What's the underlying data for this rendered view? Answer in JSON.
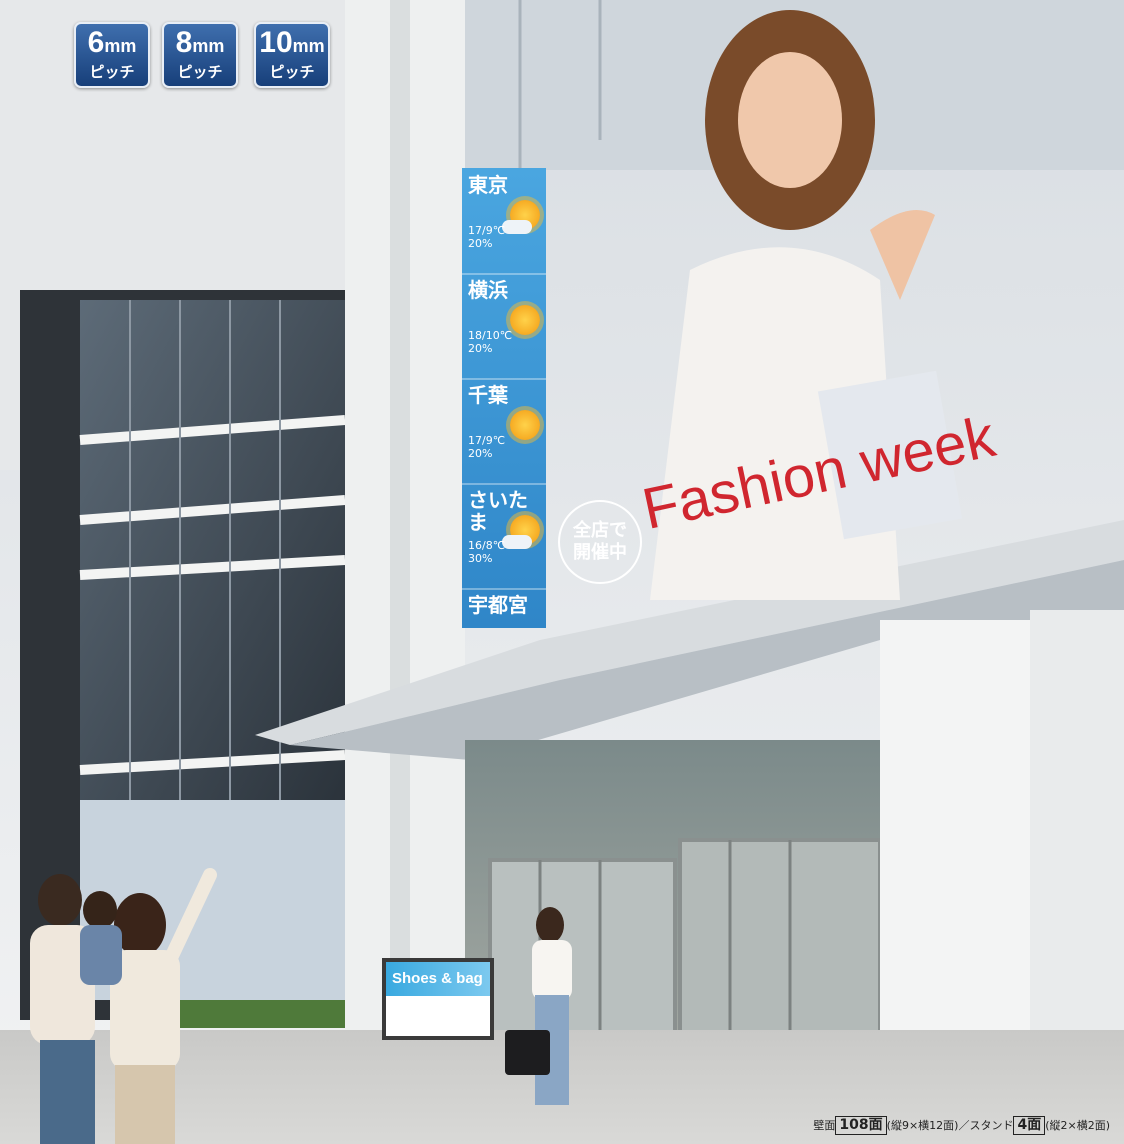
{
  "pitch_badges": [
    {
      "size": "6",
      "unit": "mm",
      "label": "ピッチ"
    },
    {
      "size": "8",
      "unit": "mm",
      "label": "ピッチ"
    },
    {
      "size": "10",
      "unit": "mm",
      "label": "ピッチ"
    }
  ],
  "weather": [
    {
      "city": "東京",
      "temp": "17/9℃",
      "chance": "20%",
      "icon": "sun-cloud-icon"
    },
    {
      "city": "横浜",
      "temp": "18/10℃",
      "chance": "20%",
      "icon": "sun-icon"
    },
    {
      "city": "千葉",
      "temp": "17/9℃",
      "chance": "20%",
      "icon": "sun-icon"
    },
    {
      "city": "さいたま",
      "temp": "16/8℃",
      "chance": "30%",
      "icon": "sun-cloud-icon"
    },
    {
      "city": "宇都宮",
      "temp": "",
      "chance": "",
      "icon": ""
    }
  ],
  "billboard": {
    "headline": "Fashion week",
    "badge_line1": "全店で",
    "badge_line2": "開催中"
  },
  "stand_sign": {
    "text": "Shoes & bag"
  },
  "caption": {
    "wall_prefix": "壁面",
    "wall_count": "108面",
    "wall_detail": "(縦9×横12面)",
    "separator": "／",
    "stand_prefix": "スタンド",
    "stand_count": "4面",
    "stand_detail": "(縦2×横2面)"
  },
  "colors": {
    "badge": "#1f4f8f",
    "headline": "#d0262f",
    "weather_panel": "#3a95d4"
  }
}
